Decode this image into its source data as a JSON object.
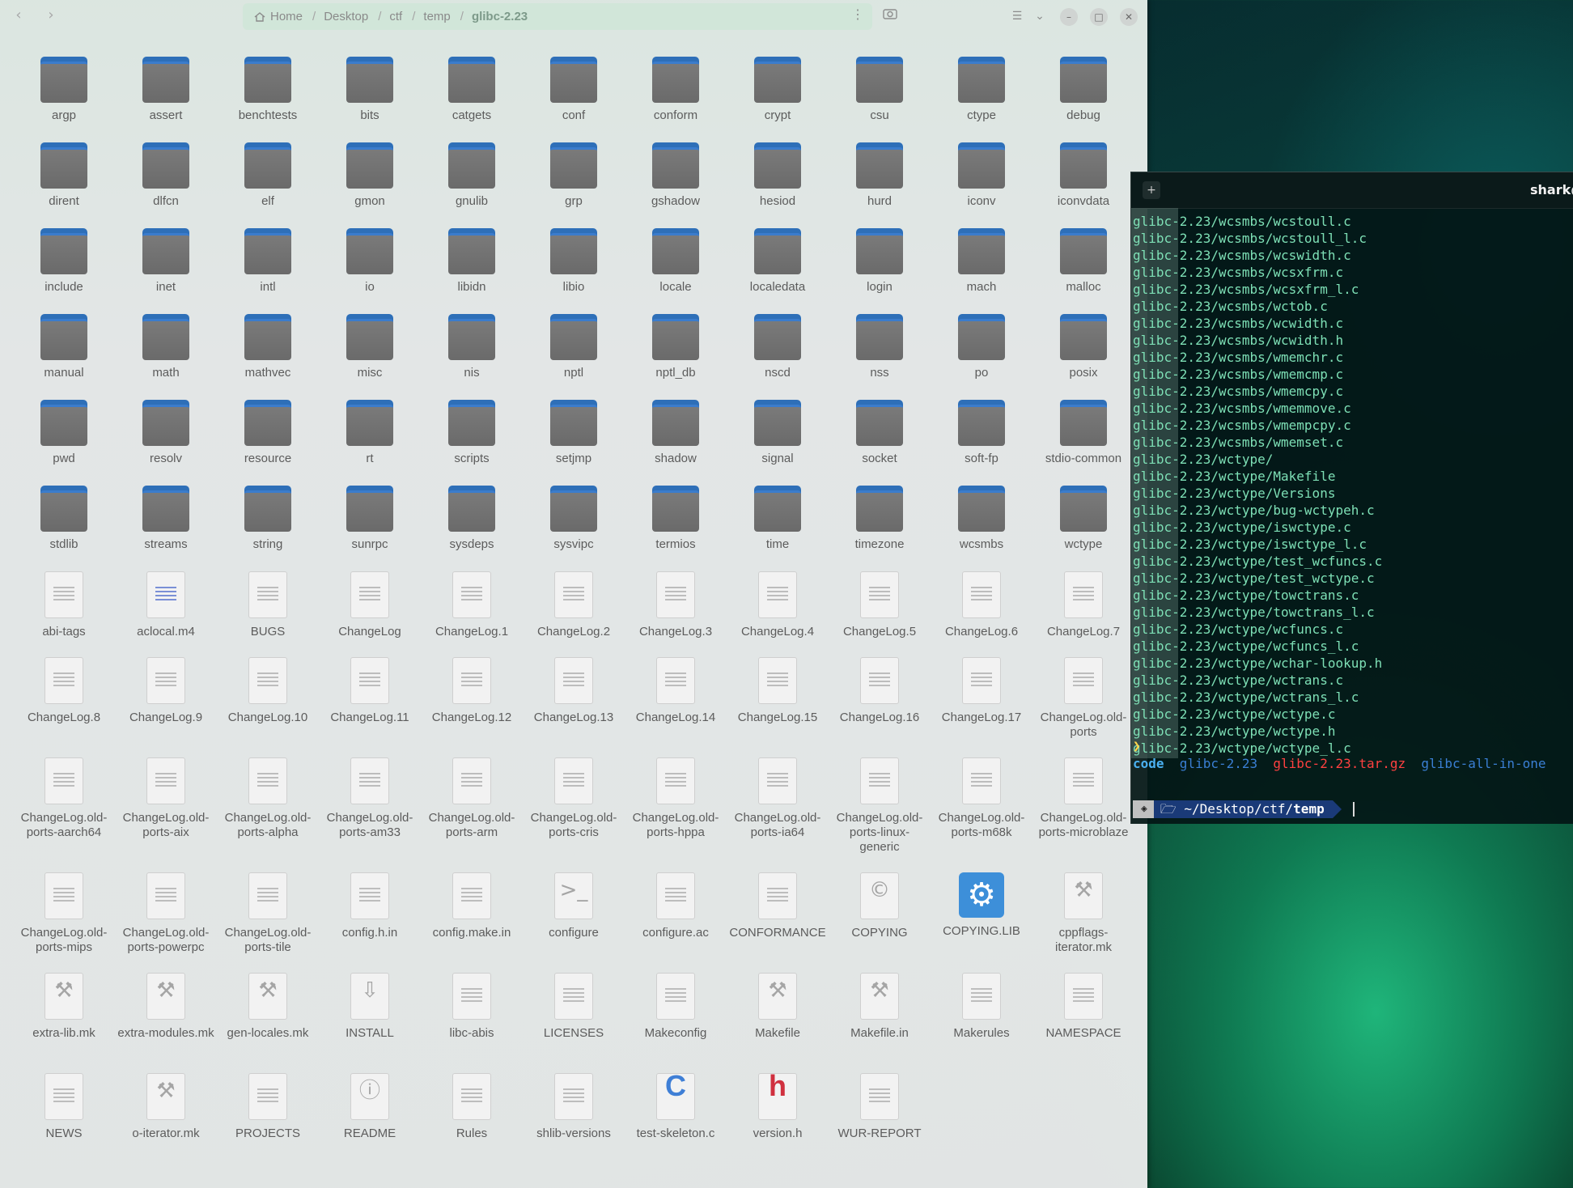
{
  "file_manager": {
    "path": [
      "Home",
      "Desktop",
      "ctf",
      "temp",
      "glibc-2.23"
    ],
    "items": [
      {
        "name": "argp",
        "type": "folder"
      },
      {
        "name": "assert",
        "type": "folder"
      },
      {
        "name": "benchtests",
        "type": "folder"
      },
      {
        "name": "bits",
        "type": "folder"
      },
      {
        "name": "catgets",
        "type": "folder"
      },
      {
        "name": "conf",
        "type": "folder"
      },
      {
        "name": "conform",
        "type": "folder"
      },
      {
        "name": "crypt",
        "type": "folder"
      },
      {
        "name": "csu",
        "type": "folder"
      },
      {
        "name": "ctype",
        "type": "folder"
      },
      {
        "name": "debug",
        "type": "folder"
      },
      {
        "name": "dirent",
        "type": "folder"
      },
      {
        "name": "dlfcn",
        "type": "folder"
      },
      {
        "name": "elf",
        "type": "folder"
      },
      {
        "name": "gmon",
        "type": "folder"
      },
      {
        "name": "gnulib",
        "type": "folder"
      },
      {
        "name": "grp",
        "type": "folder"
      },
      {
        "name": "gshadow",
        "type": "folder"
      },
      {
        "name": "hesiod",
        "type": "folder"
      },
      {
        "name": "hurd",
        "type": "folder"
      },
      {
        "name": "iconv",
        "type": "folder"
      },
      {
        "name": "iconvdata",
        "type": "folder"
      },
      {
        "name": "include",
        "type": "folder"
      },
      {
        "name": "inet",
        "type": "folder"
      },
      {
        "name": "intl",
        "type": "folder"
      },
      {
        "name": "io",
        "type": "folder"
      },
      {
        "name": "libidn",
        "type": "folder"
      },
      {
        "name": "libio",
        "type": "folder"
      },
      {
        "name": "locale",
        "type": "folder"
      },
      {
        "name": "localedata",
        "type": "folder"
      },
      {
        "name": "login",
        "type": "folder"
      },
      {
        "name": "mach",
        "type": "folder"
      },
      {
        "name": "malloc",
        "type": "folder"
      },
      {
        "name": "manual",
        "type": "folder"
      },
      {
        "name": "math",
        "type": "folder"
      },
      {
        "name": "mathvec",
        "type": "folder"
      },
      {
        "name": "misc",
        "type": "folder"
      },
      {
        "name": "nis",
        "type": "folder"
      },
      {
        "name": "nptl",
        "type": "folder"
      },
      {
        "name": "nptl_db",
        "type": "folder"
      },
      {
        "name": "nscd",
        "type": "folder"
      },
      {
        "name": "nss",
        "type": "folder"
      },
      {
        "name": "po",
        "type": "folder"
      },
      {
        "name": "posix",
        "type": "folder"
      },
      {
        "name": "pwd",
        "type": "folder"
      },
      {
        "name": "resolv",
        "type": "folder"
      },
      {
        "name": "resource",
        "type": "folder"
      },
      {
        "name": "rt",
        "type": "folder"
      },
      {
        "name": "scripts",
        "type": "folder"
      },
      {
        "name": "setjmp",
        "type": "folder"
      },
      {
        "name": "shadow",
        "type": "folder"
      },
      {
        "name": "signal",
        "type": "folder"
      },
      {
        "name": "socket",
        "type": "folder"
      },
      {
        "name": "soft-fp",
        "type": "folder"
      },
      {
        "name": "stdio-common",
        "type": "folder"
      },
      {
        "name": "stdlib",
        "type": "folder"
      },
      {
        "name": "streams",
        "type": "folder"
      },
      {
        "name": "string",
        "type": "folder"
      },
      {
        "name": "sunrpc",
        "type": "folder"
      },
      {
        "name": "sysdeps",
        "type": "folder"
      },
      {
        "name": "sysvipc",
        "type": "folder"
      },
      {
        "name": "termios",
        "type": "folder"
      },
      {
        "name": "time",
        "type": "folder"
      },
      {
        "name": "timezone",
        "type": "folder"
      },
      {
        "name": "wcsmbs",
        "type": "folder"
      },
      {
        "name": "wctype",
        "type": "folder"
      },
      {
        "name": "abi-tags",
        "type": "text"
      },
      {
        "name": "aclocal.m4",
        "type": "aclocal"
      },
      {
        "name": "BUGS",
        "type": "text"
      },
      {
        "name": "ChangeLog",
        "type": "text"
      },
      {
        "name": "ChangeLog.1",
        "type": "text"
      },
      {
        "name": "ChangeLog.2",
        "type": "text"
      },
      {
        "name": "ChangeLog.3",
        "type": "text"
      },
      {
        "name": "ChangeLog.4",
        "type": "text"
      },
      {
        "name": "ChangeLog.5",
        "type": "text"
      },
      {
        "name": "ChangeLog.6",
        "type": "text"
      },
      {
        "name": "ChangeLog.7",
        "type": "text"
      },
      {
        "name": "ChangeLog.8",
        "type": "text"
      },
      {
        "name": "ChangeLog.9",
        "type": "text"
      },
      {
        "name": "ChangeLog.10",
        "type": "text"
      },
      {
        "name": "ChangeLog.11",
        "type": "text"
      },
      {
        "name": "ChangeLog.12",
        "type": "text"
      },
      {
        "name": "ChangeLog.13",
        "type": "text"
      },
      {
        "name": "ChangeLog.14",
        "type": "text"
      },
      {
        "name": "ChangeLog.15",
        "type": "text"
      },
      {
        "name": "ChangeLog.16",
        "type": "text"
      },
      {
        "name": "ChangeLog.17",
        "type": "text"
      },
      {
        "name": "ChangeLog.old-ports",
        "type": "text"
      },
      {
        "name": "ChangeLog.old-ports-aarch64",
        "type": "text"
      },
      {
        "name": "ChangeLog.old-ports-aix",
        "type": "text"
      },
      {
        "name": "ChangeLog.old-ports-alpha",
        "type": "text"
      },
      {
        "name": "ChangeLog.old-ports-am33",
        "type": "text"
      },
      {
        "name": "ChangeLog.old-ports-arm",
        "type": "text"
      },
      {
        "name": "ChangeLog.old-ports-cris",
        "type": "text"
      },
      {
        "name": "ChangeLog.old-ports-hppa",
        "type": "text"
      },
      {
        "name": "ChangeLog.old-ports-ia64",
        "type": "text"
      },
      {
        "name": "ChangeLog.old-ports-linux-generic",
        "type": "text"
      },
      {
        "name": "ChangeLog.old-ports-m68k",
        "type": "text"
      },
      {
        "name": "ChangeLog.old-ports-microblaze",
        "type": "text"
      },
      {
        "name": "ChangeLog.old-ports-mips",
        "type": "text"
      },
      {
        "name": "ChangeLog.old-ports-powerpc",
        "type": "text"
      },
      {
        "name": "ChangeLog.old-ports-tile",
        "type": "text"
      },
      {
        "name": "config.h.in",
        "type": "text"
      },
      {
        "name": "config.make.in",
        "type": "text"
      },
      {
        "name": "configure",
        "type": "script"
      },
      {
        "name": "configure.ac",
        "type": "text"
      },
      {
        "name": "CONFORMANCE",
        "type": "text"
      },
      {
        "name": "COPYING",
        "type": "copyright"
      },
      {
        "name": "COPYING.LIB",
        "type": "gear"
      },
      {
        "name": "cppflags-iterator.mk",
        "type": "make"
      },
      {
        "name": "extra-lib.mk",
        "type": "make"
      },
      {
        "name": "extra-modules.mk",
        "type": "make"
      },
      {
        "name": "gen-locales.mk",
        "type": "make"
      },
      {
        "name": "INSTALL",
        "type": "install"
      },
      {
        "name": "libc-abis",
        "type": "text"
      },
      {
        "name": "LICENSES",
        "type": "text"
      },
      {
        "name": "Makeconfig",
        "type": "text"
      },
      {
        "name": "Makefile",
        "type": "make"
      },
      {
        "name": "Makefile.in",
        "type": "make"
      },
      {
        "name": "Makerules",
        "type": "text"
      },
      {
        "name": "NAMESPACE",
        "type": "text"
      },
      {
        "name": "NEWS",
        "type": "text"
      },
      {
        "name": "o-iterator.mk",
        "type": "make"
      },
      {
        "name": "PROJECTS",
        "type": "text"
      },
      {
        "name": "README",
        "type": "info"
      },
      {
        "name": "Rules",
        "type": "text"
      },
      {
        "name": "shlib-versions",
        "type": "text"
      },
      {
        "name": "test-skeleton.c",
        "type": "csrc"
      },
      {
        "name": "version.h",
        "type": "hsrc"
      },
      {
        "name": "WUR-REPORT",
        "type": "text"
      }
    ]
  },
  "terminal": {
    "title": "shark@",
    "lines": [
      "glibc-2.23/wcsmbs/wcstoull.c",
      "glibc-2.23/wcsmbs/wcstoull_l.c",
      "glibc-2.23/wcsmbs/wcswidth.c",
      "glibc-2.23/wcsmbs/wcsxfrm.c",
      "glibc-2.23/wcsmbs/wcsxfrm_l.c",
      "glibc-2.23/wcsmbs/wctob.c",
      "glibc-2.23/wcsmbs/wcwidth.c",
      "glibc-2.23/wcsmbs/wcwidth.h",
      "glibc-2.23/wcsmbs/wmemchr.c",
      "glibc-2.23/wcsmbs/wmemcmp.c",
      "glibc-2.23/wcsmbs/wmemcpy.c",
      "glibc-2.23/wcsmbs/wmemmove.c",
      "glibc-2.23/wcsmbs/wmempcpy.c",
      "glibc-2.23/wcsmbs/wmemset.c",
      "glibc-2.23/wctype/",
      "glibc-2.23/wctype/Makefile",
      "glibc-2.23/wctype/Versions",
      "glibc-2.23/wctype/bug-wctypeh.c",
      "glibc-2.23/wctype/iswctype.c",
      "glibc-2.23/wctype/iswctype_l.c",
      "glibc-2.23/wctype/test_wcfuncs.c",
      "glibc-2.23/wctype/test_wctype.c",
      "glibc-2.23/wctype/towctrans.c",
      "glibc-2.23/wctype/towctrans_l.c",
      "glibc-2.23/wctype/wcfuncs.c",
      "glibc-2.23/wctype/wcfuncs_l.c",
      "glibc-2.23/wctype/wchar-lookup.h",
      "glibc-2.23/wctype/wctrans.c",
      "glibc-2.23/wctype/wctrans_l.c",
      "glibc-2.23/wctype/wctype.c",
      "glibc-2.23/wctype/wctype.h",
      "glibc-2.23/wctype/wctype_l.c"
    ],
    "prompt_symbol": "❯",
    "ls": {
      "code": "code",
      "glibc": "glibc-2.23",
      "tar": "glibc-2.23.tar.gz",
      "aio": "glibc-all-in-one"
    },
    "powerline": {
      "dir_prefix": "~/Desktop/ctf/",
      "dir_current": "temp"
    }
  }
}
